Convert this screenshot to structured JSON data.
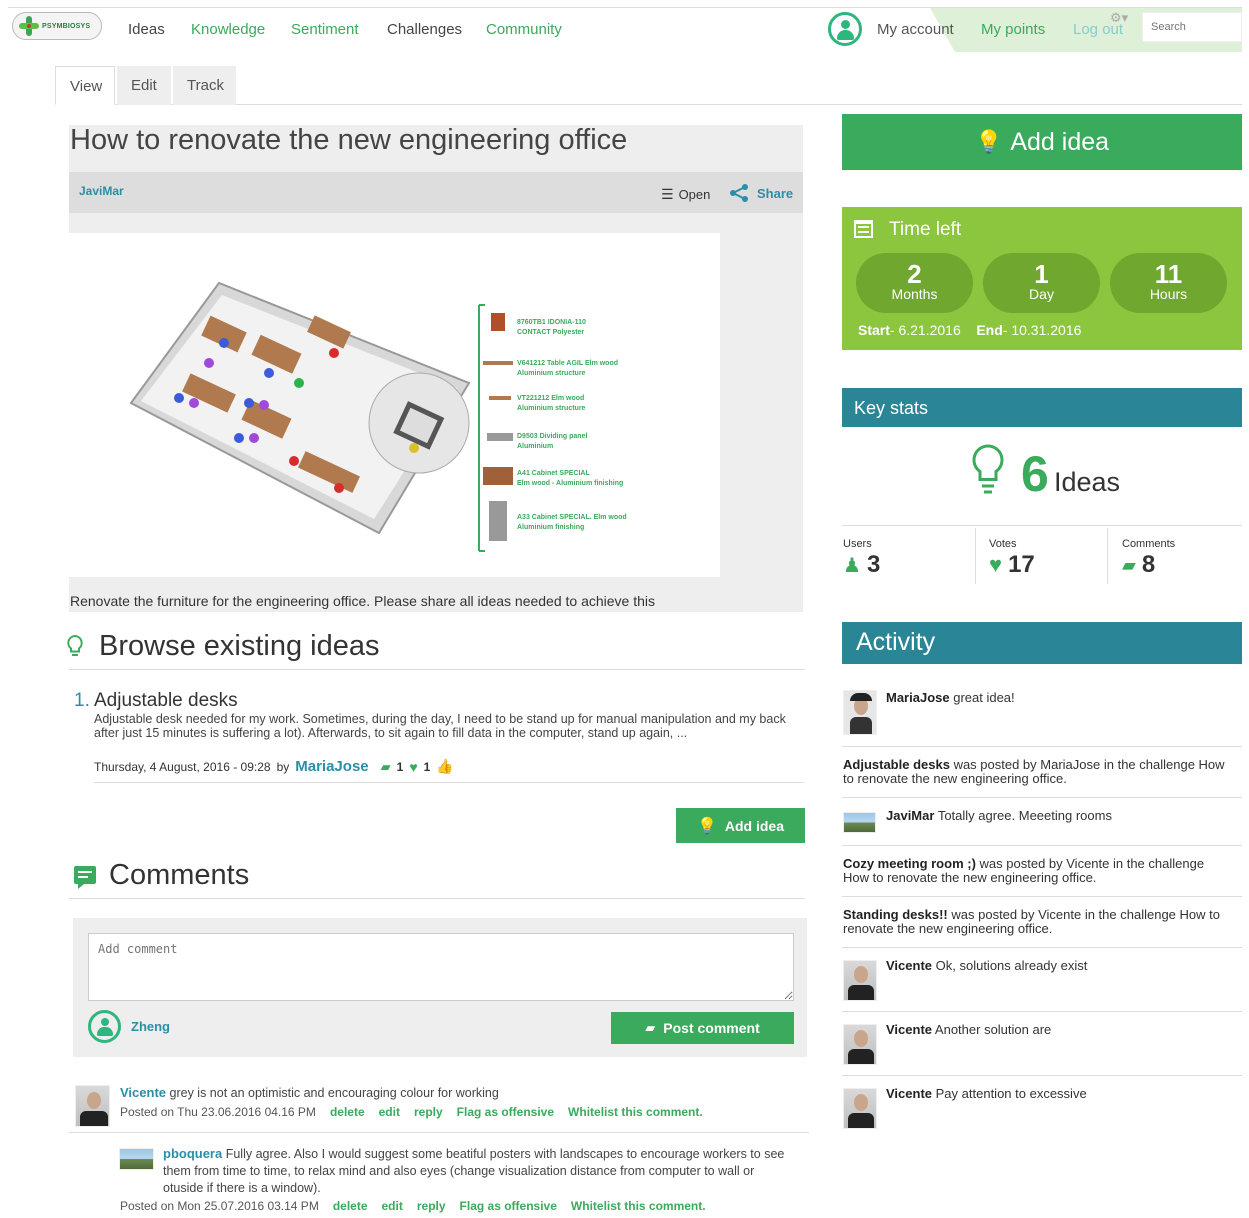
{
  "nav": {
    "logo_text": "PSYMBIOSYS",
    "items": [
      "Ideas",
      "Knowledge",
      "Sentiment",
      "Challenges",
      "Community"
    ],
    "my_account": "My account",
    "my_points": "My points",
    "logout": "Log out",
    "search_placeholder": "Search"
  },
  "tabs": [
    "View",
    "Edit",
    "Track"
  ],
  "challenge": {
    "title": "How to renovate the new engineering office",
    "author": "JaviMar",
    "status": "Open",
    "share": "Share",
    "description": "Renovate the furniture for the engineering office. Please share all ideas needed to achieve this",
    "legend": [
      {
        "code": "8760TB1 IDONIA-110",
        "desc": "CONTACT Polyester"
      },
      {
        "code": "V641212 Table AGIL Elm wood",
        "desc": "Aluminium structure"
      },
      {
        "code": "VT221212 Elm wood",
        "desc": "Aluminium structure"
      },
      {
        "code": "D9503 Dividing panel",
        "desc": "Aluminium"
      },
      {
        "code": "A41 Cabinet SPECIAL",
        "desc": "Elm wood - Aluminium finishing"
      },
      {
        "code": "A33 Cabinet SPECIAL. Elm wood",
        "desc": "Aluminium finishing"
      }
    ]
  },
  "browse": {
    "heading": "Browse existing ideas",
    "ideas": [
      {
        "number": "1.",
        "title": "Adjustable desks",
        "text": "Adjustable desk needed for my work. Sometimes, during the day, I need to be stand up for manual manipulation and my back after just 15 minutes is suffering a lot). Afterwards, to sit again to fill data in the computer, stand up again, ...",
        "date": "Thursday, 4 August, 2016 - 09:28",
        "by": "by",
        "user": "MariaJose",
        "comments": "1",
        "votes": "1"
      }
    ],
    "add_idea": "Add idea"
  },
  "comments": {
    "heading": "Comments",
    "placeholder": "Add comment",
    "current_user": "Zheng",
    "post_button": "Post comment",
    "items": [
      {
        "user": "Vicente",
        "text": "grey is not an optimistic and encouraging colour for working",
        "posted": "Posted on Thu 23.06.2016 04.16 PM"
      },
      {
        "user": "pboquera",
        "text1": "Fully agree. Also I would suggest some beatiful posters with landscapes to encourage workers to see",
        "text2": "them from time to time, to relax mind and also eyes (change visualization distance from computer to wall or",
        "text3": "otuside if there is a window).",
        "posted": "Posted on Mon 25.07.2016 03.14 PM"
      }
    ],
    "actions": [
      "delete",
      "edit",
      "reply",
      "Flag as offensive",
      "Whitelist this comment."
    ]
  },
  "sidebar": {
    "add_idea": "Add idea",
    "time_left": {
      "title": "Time left",
      "pills": [
        {
          "value": "2",
          "unit": "Months"
        },
        {
          "value": "1",
          "unit": "Day"
        },
        {
          "value": "11",
          "unit": "Hours"
        }
      ],
      "start_label": "Start",
      "start": "- 6.21.2016",
      "end_label": "End",
      "end": "- 10.31.2016"
    },
    "key_stats": {
      "title": "Key stats",
      "ideas_count": "6",
      "ideas_label": "Ideas",
      "users_label": "Users",
      "users": "3",
      "votes_label": "Votes",
      "votes": "17",
      "comments_label": "Comments",
      "comments": "8"
    },
    "activity": {
      "title": "Activity",
      "items": [
        {
          "user": "MariaJose",
          "text": "great idea!"
        },
        {
          "bold": "Adjustable desks",
          "text1": "was posted by MariaJose in the challenge How",
          "text2": "to renovate the new engineering office."
        },
        {
          "user": "JaviMar",
          "text": "Totally agree. Meeeting rooms"
        },
        {
          "bold": "Cozy meeting room ;)",
          "text1": "was posted by Vicente in the challenge",
          "text2": "How to renovate the new engineering office."
        },
        {
          "bold": "Standing desks!!",
          "text1": "was posted by Vicente in the challenge How to",
          "text2": "renovate the new engineering office."
        },
        {
          "user": "Vicente",
          "text": "Ok, solutions already exist"
        },
        {
          "user": "Vicente",
          "text": "Another solution are"
        },
        {
          "user": "Vicente",
          "text": "Pay attention to excessive"
        }
      ]
    }
  },
  "colors": {
    "brand_green": "#3aaa5c",
    "lime": "#8cc63f",
    "teal": "#2a8696",
    "link_blue": "#2a8fa6"
  }
}
